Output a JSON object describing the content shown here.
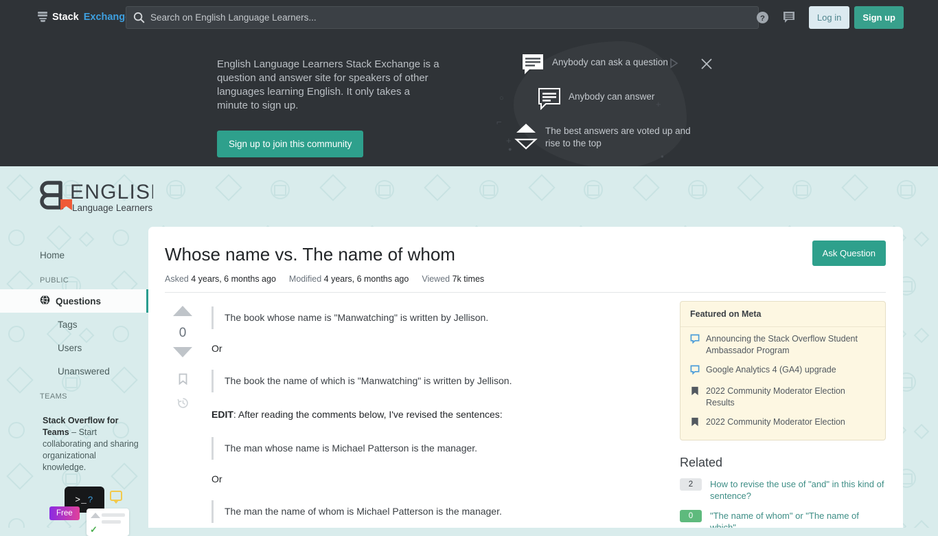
{
  "topnav": {
    "brand_stack": "Stack",
    "brand_exchange": "Exchange",
    "search_placeholder": "Search on English Language Learners...",
    "search_value": "",
    "help_icon": "help-circle-icon",
    "inbox_icon": "inbox-bubble-icon",
    "login_label": "Log in",
    "signup_label": "Sign up"
  },
  "hero": {
    "description": "English Language Learners Stack Exchange is a question and answer site for speakers of other languages learning English. It only takes a minute to sign up.",
    "cta_label": "Sign up to join this community",
    "close_icon": "close-icon",
    "play_icon": "play-triangle-icon",
    "features": [
      {
        "icon": "speech-bubble-filled-icon",
        "text": "Anybody can ask a question"
      },
      {
        "icon": "speech-bubble-outline-icon",
        "text": "Anybody can answer"
      },
      {
        "icon": "vote-arrows-icon",
        "text": "The best answers are voted up and rise to the top"
      }
    ]
  },
  "sitelogo": {
    "title": "ENGLISH",
    "subtitle": "Language Learners"
  },
  "sidebar": {
    "home_label": "Home",
    "public_heading": "PUBLIC",
    "teams_heading": "TEAMS",
    "items": [
      {
        "label": "Questions",
        "icon": "globe-icon",
        "active": true
      },
      {
        "label": "Tags",
        "active": false
      },
      {
        "label": "Users",
        "active": false
      },
      {
        "label": "Unanswered",
        "active": false
      }
    ],
    "promo": {
      "bold": "Stack Overflow for Teams",
      "rest": " – Start collaborating and sharing organizational knowledge.",
      "terminal_text": ">_",
      "terminal_qm": "?",
      "free_label": "Free"
    }
  },
  "question": {
    "title": "Whose name vs. The name of whom",
    "asked_label": "Asked",
    "asked_value": "4 years, 6 months ago",
    "modified_label": "Modified",
    "modified_value": "4 years, 6 months ago",
    "viewed_label": "Viewed",
    "viewed_value": "7k times",
    "ask_button": "Ask Question",
    "vote_count": "0",
    "upvote_icon": "upvote-arrow-icon",
    "downvote_icon": "downvote-arrow-icon",
    "bookmark_icon": "bookmark-icon",
    "history_icon": "history-clock-icon",
    "body": {
      "quote1": "The book whose name is \"Manwatching\" is written by Jellison.",
      "or1": "Or",
      "quote2": "The book the name of which is \"Manwatching\" is written by Jellison.",
      "edit_bold": "EDIT",
      "edit_rest": ": After reading the comments below, I've revised the sentences:",
      "quote3": "The man whose name is Michael Patterson is the manager.",
      "or2": "Or",
      "quote4": "The man the name of whom is Michael Patterson is the manager."
    }
  },
  "featured_on_meta": {
    "heading": "Featured on Meta",
    "items": [
      {
        "icon": "meta-bubble-icon",
        "text": "Announcing the Stack Overflow Student Ambassador Program"
      },
      {
        "icon": "meta-bubble-icon",
        "text": "Google Analytics 4 (GA4) upgrade"
      },
      {
        "icon": "meta-bookmark-icon",
        "text": "2022 Community Moderator Election Results"
      },
      {
        "icon": "meta-bookmark-icon",
        "text": "2022 Community Moderator Election"
      }
    ]
  },
  "related": {
    "heading": "Related",
    "items": [
      {
        "score": "2",
        "accepted": false,
        "title": "How to revise the use of \"and\" in this kind of sentence?"
      },
      {
        "score": "0",
        "accepted": true,
        "title": "\"The name of whom\" or \"The name of which\""
      }
    ]
  },
  "colors": {
    "accent_teal": "#2ea08c",
    "nav_dark": "#2f3337",
    "page_bg": "#d9ecec",
    "meta_bg": "#fdf7e2",
    "link_teal": "#3e8e86"
  }
}
